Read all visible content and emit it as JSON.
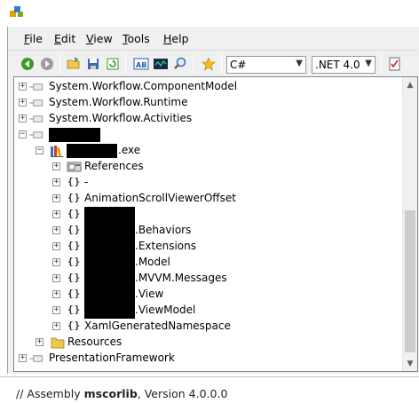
{
  "menu": [
    {
      "label": "File",
      "key": "F",
      "rest": "ile"
    },
    {
      "label": "Edit",
      "key": "E",
      "rest": "dit"
    },
    {
      "label": "View",
      "key": "V",
      "rest": "iew"
    },
    {
      "label": "Tools",
      "key": "T",
      "rest": "ools"
    },
    {
      "label": "Help",
      "key": "H",
      "rest": "elp"
    }
  ],
  "toolbar": {
    "language": "C#",
    "framework": ".NET 4.0"
  },
  "tree": {
    "rows": [
      {
        "label": "System.Workflow.ComponentModel"
      },
      {
        "label": "System.Workflow.Runtime"
      },
      {
        "label": "System.Workflow.Activities"
      },
      {
        "label": ""
      },
      {
        "label": ".exe"
      },
      {
        "label": "References"
      },
      {
        "label": "-"
      },
      {
        "label": "AnimationScrollViewerOffset"
      },
      {
        "label": ""
      },
      {
        "label": ".Behaviors"
      },
      {
        "label": ".Extensions"
      },
      {
        "label": ".Model"
      },
      {
        "label": ".MVVM.Messages"
      },
      {
        "label": ".View"
      },
      {
        "label": ".ViewModel"
      },
      {
        "label": "XamlGeneratedNamespace"
      },
      {
        "label": "Resources"
      },
      {
        "label": "PresentationFramework"
      }
    ]
  },
  "status": {
    "prefix": "// Assembly ",
    "assembly": "mscorlib",
    "suffix": ", Version 4.0.0.0"
  },
  "colors": {
    "accent_green": "#3a9a2a",
    "folder_yellow": "#f0c850",
    "star_gold": "#f2c01e"
  }
}
